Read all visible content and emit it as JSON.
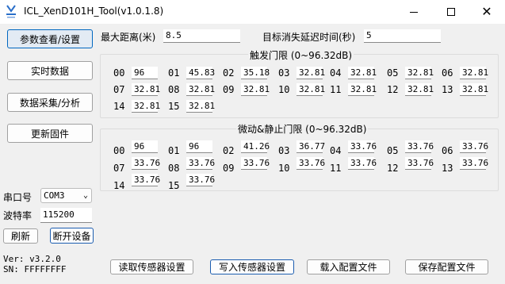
{
  "window": {
    "title": "ICL_XenD101H_Tool(v1.0.1.8)"
  },
  "nav": {
    "params": "参数查看/设置",
    "realtime": "实时数据",
    "collect": "数据采集/分析",
    "firmware": "更新固件"
  },
  "settings": {
    "max_distance_label": "最大距离(米)",
    "max_distance_value": "8.5",
    "delay_label": "目标消失延迟时间(秒)",
    "delay_value": "5"
  },
  "trigger": {
    "title": "触发门限 (0~96.32dB)",
    "cells": [
      {
        "id": "00",
        "value": "96"
      },
      {
        "id": "01",
        "value": "45.83"
      },
      {
        "id": "02",
        "value": "35.18"
      },
      {
        "id": "03",
        "value": "32.81"
      },
      {
        "id": "04",
        "value": "32.81"
      },
      {
        "id": "05",
        "value": "32.81"
      },
      {
        "id": "06",
        "value": "32.81"
      },
      {
        "id": "07",
        "value": "32.81"
      },
      {
        "id": "08",
        "value": "32.81"
      },
      {
        "id": "09",
        "value": "32.81"
      },
      {
        "id": "10",
        "value": "32.81"
      },
      {
        "id": "11",
        "value": "32.81"
      },
      {
        "id": "12",
        "value": "32.81"
      },
      {
        "id": "13",
        "value": "32.81"
      },
      {
        "id": "14",
        "value": "32.81"
      },
      {
        "id": "15",
        "value": "32.81"
      }
    ]
  },
  "motion": {
    "title": "微动&静止门限 (0~96.32dB)",
    "cells": [
      {
        "id": "00",
        "value": "96"
      },
      {
        "id": "01",
        "value": "96"
      },
      {
        "id": "02",
        "value": "41.26"
      },
      {
        "id": "03",
        "value": "36.77"
      },
      {
        "id": "04",
        "value": "33.76"
      },
      {
        "id": "05",
        "value": "33.76"
      },
      {
        "id": "06",
        "value": "33.76"
      },
      {
        "id": "07",
        "value": "33.76"
      },
      {
        "id": "08",
        "value": "33.76"
      },
      {
        "id": "09",
        "value": "33.76"
      },
      {
        "id": "10",
        "value": "33.76"
      },
      {
        "id": "11",
        "value": "33.76"
      },
      {
        "id": "12",
        "value": "33.76"
      },
      {
        "id": "13",
        "value": "33.76"
      },
      {
        "id": "14",
        "value": "33.76"
      },
      {
        "id": "15",
        "value": "33.76"
      }
    ]
  },
  "serial": {
    "port_label": "串口号",
    "port_value": "COM3",
    "baud_label": "波特率",
    "baud_value": "115200",
    "refresh": "刷新",
    "disconnect": "断开设备"
  },
  "info": {
    "ver": "Ver: v3.2.0",
    "sn": "SN: FFFFFFFF"
  },
  "actions": {
    "read": "读取传感器设置",
    "write": "写入传感器设置",
    "load": "载入配置文件",
    "save": "保存配置文件"
  }
}
